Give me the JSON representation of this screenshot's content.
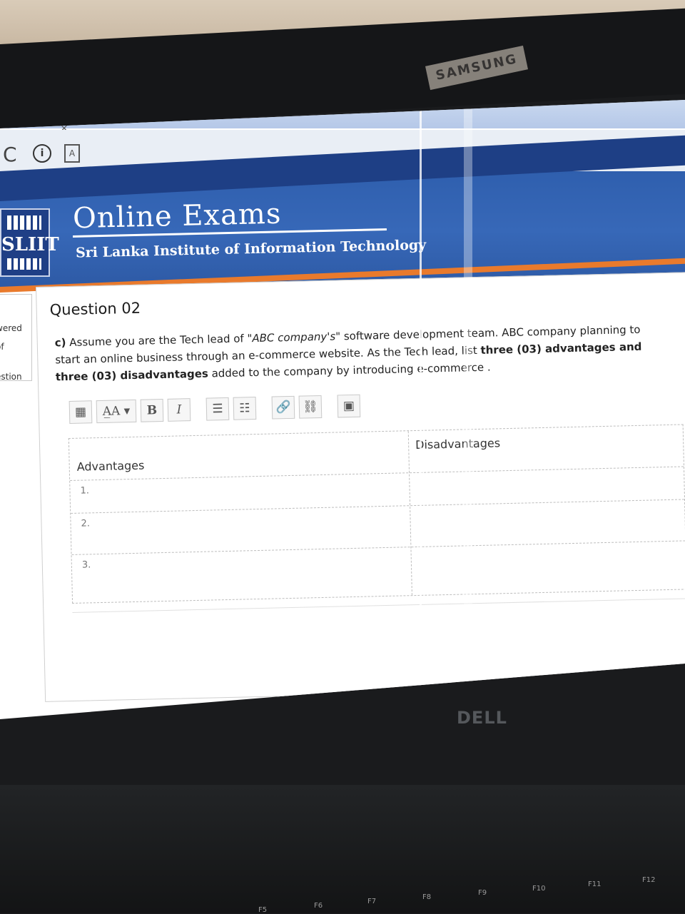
{
  "browser": {
    "tab_close": "×",
    "reload_icon": "C",
    "info_icon": "i",
    "page_icon": "A"
  },
  "header": {
    "logo_text": "SLIIT",
    "title": "Online Exams",
    "subtitle": "Sri Lanka Institute of Information Technology"
  },
  "leftnav": {
    "item1": "wered",
    "item2": "of",
    "item3": "estion"
  },
  "question": {
    "number": "Question 02",
    "part": "c)",
    "text1": "Assume you are the Tech lead of \"",
    "company": "ABC company's\"",
    "text2": " software development team. ABC company planning to start an online business through an e-commerce website. As the Tech lead, list ",
    "bold1": "three (03) advantages and three (03) disadvantages",
    "text3": " added to the company by introducing e-commerce ."
  },
  "editor": {
    "btn_format": "A̲A ▾",
    "btn_bold": "B",
    "btn_italic": "I",
    "btn_ul": "☰",
    "btn_ol": "☷",
    "btn_link": "🔗",
    "btn_unlink": "⛓",
    "btn_image": "▣"
  },
  "table": {
    "col_advantages": "Advantages",
    "col_disadvantages": "Disadvantages",
    "rows": [
      "1.",
      "2.",
      "3."
    ]
  },
  "laptop": {
    "brand": "DELL",
    "sticker": "SAMSUNG",
    "fkeys": [
      "F5",
      "F6",
      "F7",
      "F8",
      "F9",
      "F10",
      "F11",
      "F12"
    ]
  }
}
